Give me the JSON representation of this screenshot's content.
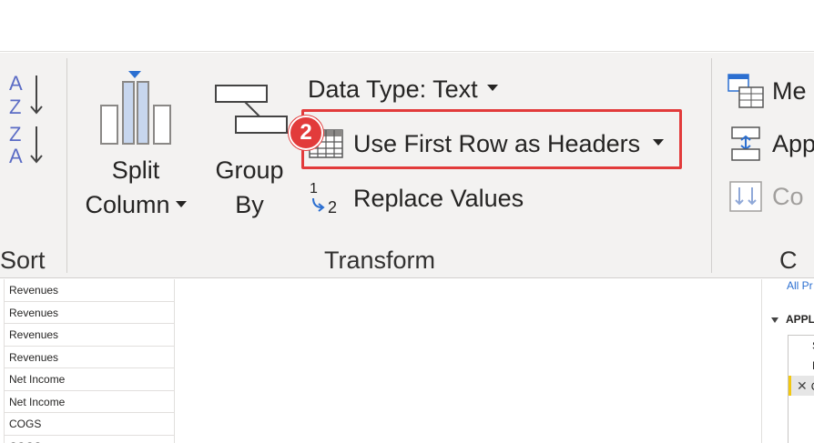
{
  "ribbon": {
    "sort": {
      "label": "Sort",
      "sort_asc_icon": "sort-ascending-icon",
      "sort_desc_icon": "sort-descending-icon"
    },
    "transform": {
      "label": "Transform",
      "split_column": {
        "line1": "Split",
        "line2": "Column",
        "icon": "split-column-icon"
      },
      "group_by": {
        "line1": "Group",
        "line2": "By",
        "icon": "group-by-icon"
      },
      "data_type": {
        "label": "Data Type: Text"
      },
      "use_first_row": {
        "label": "Use First Row as Headers",
        "icon": "table-grid-icon"
      },
      "replace_values": {
        "label": "Replace Values",
        "icon": "replace-values-icon"
      }
    },
    "combine": {
      "label": "C",
      "merge": {
        "label": "Me",
        "icon": "merge-queries-icon"
      },
      "append": {
        "label": "App",
        "icon": "append-queries-icon"
      },
      "combine_files": {
        "label": "Co",
        "icon": "combine-files-icon"
      }
    }
  },
  "callout": {
    "step_number": "2",
    "color": "#e23b3b"
  },
  "grid": {
    "rows": [
      "Revenues",
      "Revenues",
      "Revenues",
      "Revenues",
      "Net Income",
      "Net Income",
      "COGS",
      "COGS"
    ]
  },
  "query_settings": {
    "all_properties_link": "All Pr",
    "applied_steps_heading": "APPL",
    "steps": [
      "S",
      "N",
      "C"
    ],
    "delete_glyph": "✕"
  },
  "colors": {
    "ribbon_bg": "#f3f2f1",
    "accent_blue": "#2b6fd1",
    "highlight_red": "#e23b3b",
    "active_step": "#f2c811"
  }
}
